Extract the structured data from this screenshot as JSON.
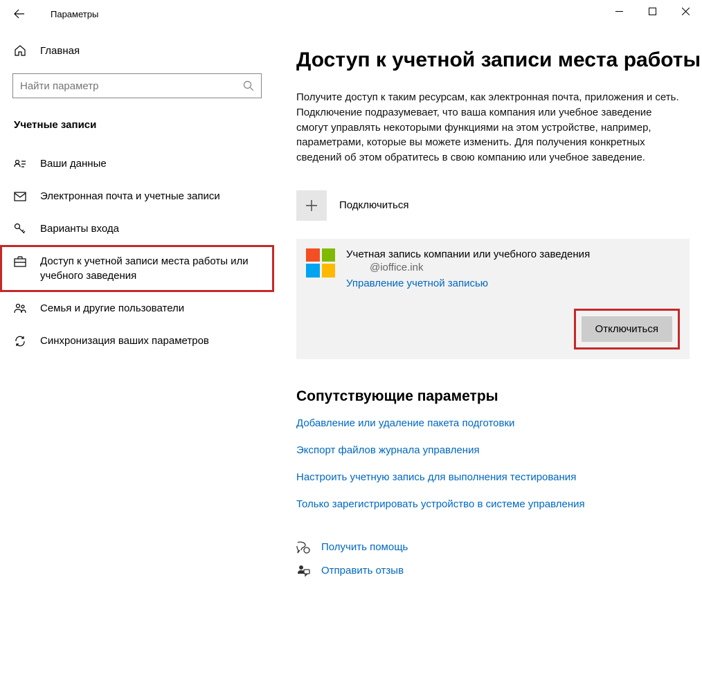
{
  "titlebar": {
    "title": "Параметры"
  },
  "sidebar": {
    "home": "Главная",
    "search_placeholder": "Найти параметр",
    "section": "Учетные записи",
    "items": [
      {
        "label": "Ваши данные"
      },
      {
        "label": "Электронная почта и учетные записи"
      },
      {
        "label": "Варианты входа"
      },
      {
        "label": "Доступ к учетной записи места работы или учебного заведения"
      },
      {
        "label": "Семья и другие пользователи"
      },
      {
        "label": "Синхронизация ваших параметров"
      }
    ]
  },
  "main": {
    "title": "Доступ к учетной записи места работы",
    "description": "Получите доступ к таким ресурсам, как электронная почта, приложения и сеть. Подключение подразумевает, что ваша компания или учебное заведение смогут управлять некоторыми функциями на этом устройстве, например, параметрами, которые вы можете изменить. Для получения конкретных сведений об этом обратитесь в свою компанию или учебное заведение.",
    "connect_label": "Подключиться",
    "account": {
      "title": "Учетная запись компании или учебного заведения",
      "email": "@ioffice.ink",
      "manage": "Управление учетной записью",
      "disconnect": "Отключиться"
    },
    "related_header": "Сопутствующие параметры",
    "related_links": [
      "Добавление или удаление пакета подготовки",
      "Экспорт файлов журнала управления",
      "Настроить учетную запись для выполнения тестирования",
      "Только зарегистрировать устройство в системе управления"
    ],
    "help": "Получить помощь",
    "feedback": "Отправить отзыв"
  }
}
